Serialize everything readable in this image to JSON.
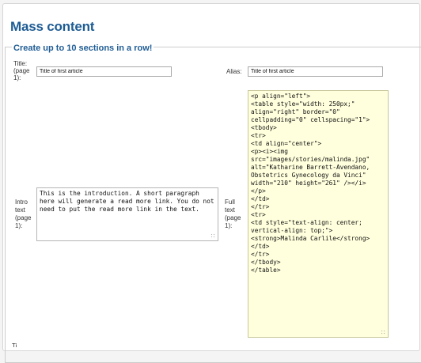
{
  "page": {
    "title": "Mass content"
  },
  "section": {
    "legend": "Create up to 10 sections in a row!",
    "title_label": "Title:",
    "title_page_label": "(page",
    "title_page_num": "1):",
    "title_value": "Title of first article",
    "alias_label": "Alias:",
    "alias_value": "Title of first article",
    "intro_label_1": "Intro",
    "intro_label_2": "text",
    "intro_label_3": "(page",
    "intro_label_4": "1):",
    "intro_value": "This is the introduction. A short paragraph here will generate a read more link. You do not need to put the read more link in the text.",
    "full_label_1": "Full",
    "full_label_2": "text",
    "full_label_3": "(page",
    "full_label_4": "1):",
    "full_value": "<p align=\"left\">\n<table style=\"width: 250px;\" align=\"right\" border=\"0\" cellpadding=\"0\" cellspacing=\"1\">\n<tbody>\n<tr>\n<td align=\"center\">\n<p><i><img src=\"images/stories/malinda.jpg\" alt=\"Katharine Barrett-Avendano, Obstetrics Gynecology da Vinci\" width=\"210\" height=\"261\" /></i>\n</p>\n</td>\n</tr>\n<tr>\n<td style=\"text-align: center; vertical-align: top;\">\n<strong>Malinda Carlile</strong></td>\n</tr>\n</tbody>\n</table>",
    "next_label_fragment": "Ti"
  }
}
